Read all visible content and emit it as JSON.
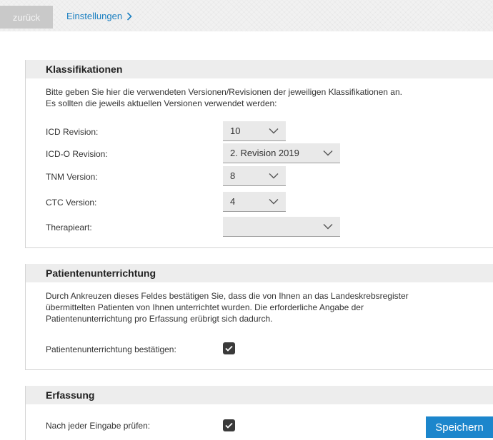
{
  "topbar": {
    "back_label": "zurück",
    "breadcrumb_label": "Einstellungen"
  },
  "klassifikationen": {
    "title": "Klassifikationen",
    "description_line1": "Bitte geben Sie hier die verwendeten Versionen/Revisionen der jeweiligen Klassifikationen an.",
    "description_line2": "Es sollten die jeweils aktuellen Versionen verwendet werden:",
    "rows": [
      {
        "label": "ICD Revision:",
        "value": "10"
      },
      {
        "label": "ICD-O Revision:",
        "value": "2. Revision 2019"
      },
      {
        "label": "TNM Version:",
        "value": "8"
      },
      {
        "label": "CTC Version:",
        "value": "4"
      },
      {
        "label": "Therapieart:",
        "value": ""
      }
    ]
  },
  "patientenunterrichtung": {
    "title": "Patientenunterrichtung",
    "description_line1": "Durch Ankreuzen dieses Feldes bestätigen Sie, dass die von Ihnen an das Landeskrebsregister",
    "description_line2": "übermittelten Patienten von Ihnen unterrichtet wurden. Die erforderliche Angabe der",
    "description_line3": "Patientenunterrichtung pro Erfassung erübrigt sich dadurch.",
    "confirm_label": "Patientenunterrichtung bestätigen:",
    "confirm_checked": true
  },
  "erfassung": {
    "title": "Erfassung",
    "check_label": "Nach jeder Eingabe prüfen:",
    "check_checked": true,
    "save_label": "Speichern"
  },
  "colors": {
    "accent": "#1c86cc",
    "link": "#1a7fc1",
    "checkbox": "#3a3a3a"
  }
}
